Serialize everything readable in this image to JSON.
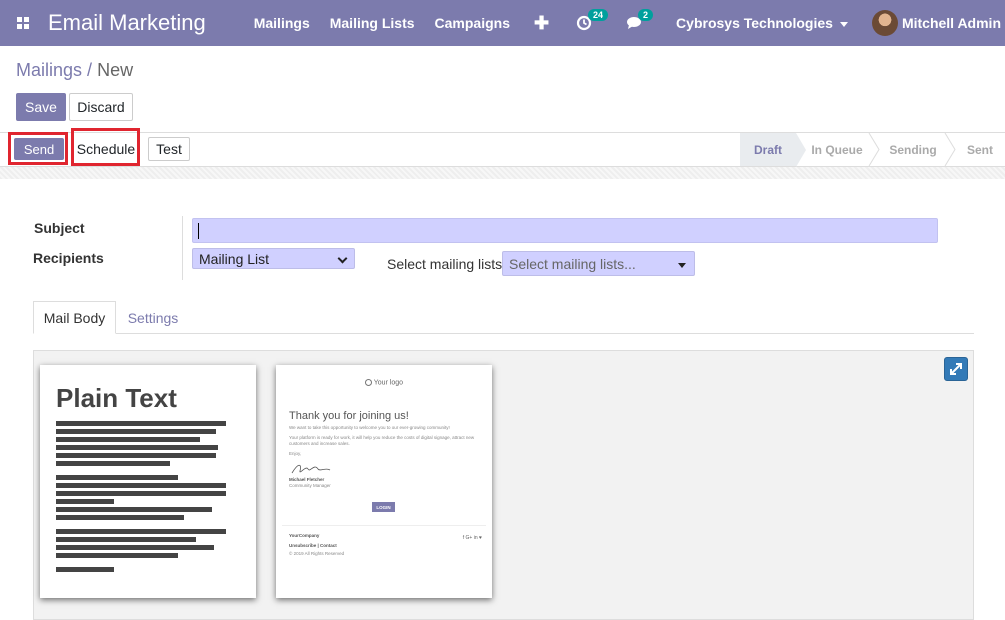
{
  "navbar": {
    "app_title": "Email Marketing",
    "menu": [
      "Mailings",
      "Mailing Lists",
      "Campaigns"
    ],
    "plus_label": "✚",
    "activity_count": "24",
    "messages_count": "2",
    "company": "Cybrosys Technologies",
    "user": "Mitchell Admin",
    "bg_color": "#7c7bad"
  },
  "breadcrumb": {
    "parent": "Mailings",
    "separator": "/",
    "current": "New"
  },
  "buttons": {
    "save": "Save",
    "discard": "Discard",
    "send": "Send",
    "schedule": "Schedule",
    "test": "Test"
  },
  "statusbar": {
    "stages": [
      "Draft",
      "In Queue",
      "Sending",
      "Sent"
    ],
    "active": "Draft"
  },
  "form": {
    "subject_label": "Subject",
    "subject_value": "",
    "recipients_label": "Recipients",
    "recipients_value": "Mailing List",
    "lists_label": "Select mailing lists:",
    "lists_placeholder": "Select mailing lists..."
  },
  "tabs": [
    "Mail Body",
    "Settings"
  ],
  "templates": {
    "plain_text_title": "Plain Text",
    "welcome": {
      "logo": "Your logo",
      "heading": "Thank you for joining us!",
      "line1": "We want to take this opportunity to welcome you to our ever-growing community!",
      "line2": "Your platform is ready for work, it will help you reduce the costs of digital signage, attract new customers and increase sales.",
      "line3": "Enjoy,",
      "signer": "Michael Fletcher",
      "signer_role": "Community Manager",
      "login": "LOGIN",
      "company": "YourCompany",
      "links": "Unsubscribe | Contact",
      "copyright": "© 2019 All Rights Reserved",
      "social": "f  G+  in  ♥"
    }
  }
}
